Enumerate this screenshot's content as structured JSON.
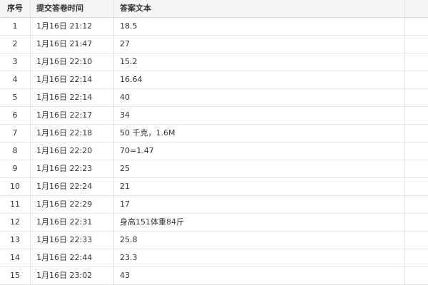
{
  "table": {
    "headers": {
      "index": "序号",
      "submit_time": "提交答卷时间",
      "answer_text": "答案文本"
    },
    "rows": [
      {
        "index": "1",
        "submit_time": "1月16日 21:12",
        "answer_text": "18.5"
      },
      {
        "index": "2",
        "submit_time": "1月16日 21:47",
        "answer_text": "27"
      },
      {
        "index": "3",
        "submit_time": "1月16日 22:10",
        "answer_text": "15.2"
      },
      {
        "index": "4",
        "submit_time": "1月16日 22:14",
        "answer_text": "16.64"
      },
      {
        "index": "5",
        "submit_time": "1月16日 22:14",
        "answer_text": "40"
      },
      {
        "index": "6",
        "submit_time": "1月16日 22:17",
        "answer_text": "34"
      },
      {
        "index": "7",
        "submit_time": "1月16日 22:18",
        "answer_text": "50 千克，1.6M"
      },
      {
        "index": "8",
        "submit_time": "1月16日 22:20",
        "answer_text": "70=1.47"
      },
      {
        "index": "9",
        "submit_time": "1月16日 22:23",
        "answer_text": "25"
      },
      {
        "index": "10",
        "submit_time": "1月16日 22:24",
        "answer_text": "21"
      },
      {
        "index": "11",
        "submit_time": "1月16日 22:29",
        "answer_text": "17"
      },
      {
        "index": "12",
        "submit_time": "1月16日 22:31",
        "answer_text": "身高151体重84斤"
      },
      {
        "index": "13",
        "submit_time": "1月16日 22:33",
        "answer_text": "25.8"
      },
      {
        "index": "14",
        "submit_time": "1月16日 22:44",
        "answer_text": "23.3"
      },
      {
        "index": "15",
        "submit_time": "1月16日 23:02",
        "answer_text": "43"
      }
    ]
  }
}
